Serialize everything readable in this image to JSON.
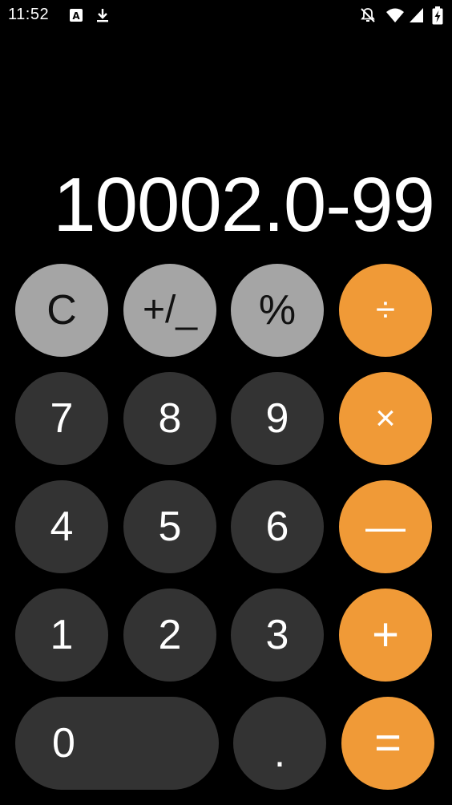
{
  "status_bar": {
    "time": "11:52",
    "icons_left": [
      "a-notification-icon",
      "download-icon"
    ],
    "icons_right": [
      "notifications-off-icon",
      "wifi-icon",
      "signal-icon",
      "battery-charging-icon"
    ]
  },
  "display": {
    "expression": "10002.0-99"
  },
  "keys": {
    "clear": "C",
    "sign": "+/_",
    "percent": "%",
    "divide": "÷",
    "seven": "7",
    "eight": "8",
    "nine": "9",
    "multiply": "×",
    "four": "4",
    "five": "5",
    "six": "6",
    "minus": "—",
    "one": "1",
    "two": "2",
    "three": "3",
    "plus": "+",
    "zero": "0",
    "decimal": ".",
    "equals": "="
  },
  "colors": {
    "background": "#000000",
    "digit_key": "#333333",
    "function_key": "#a5a5a5",
    "operator_key": "#f09a37",
    "text": "#ffffff"
  }
}
